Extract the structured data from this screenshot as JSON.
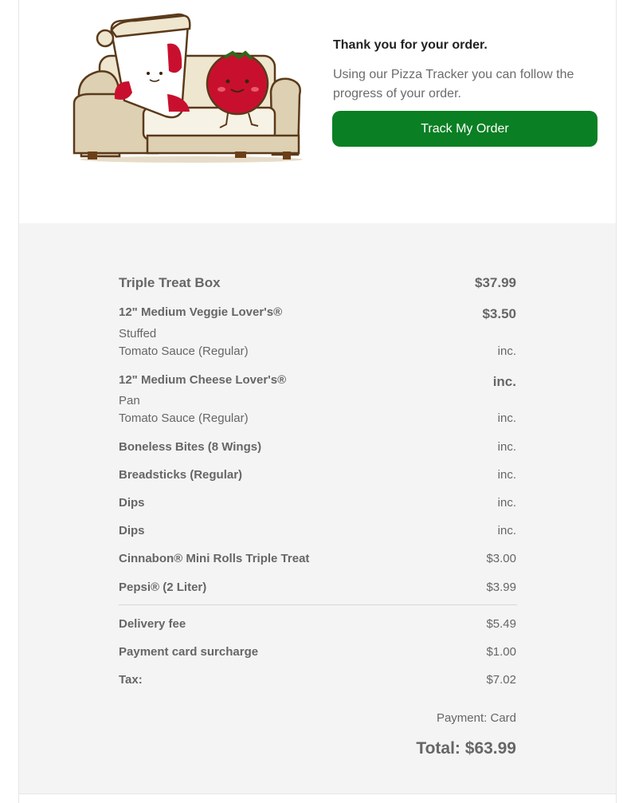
{
  "header": {
    "thanks_title": "Thank you for your order.",
    "thanks_text": "Using our Pizza Tracker you can follow the progress of your order.",
    "track_button": "Track My Order",
    "button_color": "#0a7f23"
  },
  "order": {
    "box_name": "Triple Treat Box",
    "box_price": "$37.99",
    "items": [
      {
        "name": "12\" Medium Veggie Lover's®",
        "price": "$3.50",
        "crust": "Stuffed",
        "sauce": "Tomato Sauce (Regular)",
        "sauce_price": "inc."
      },
      {
        "name": "12\" Medium Cheese Lover's®",
        "price": "inc.",
        "crust": "Pan",
        "sauce": "Tomato Sauce (Regular)",
        "sauce_price": "inc."
      },
      {
        "name": "Boneless Bites (8 Wings)",
        "price": "inc."
      },
      {
        "name": "Breadsticks (Regular)",
        "price": "inc."
      },
      {
        "name": "Dips",
        "price": "inc."
      },
      {
        "name": "Dips",
        "price": "inc."
      },
      {
        "name": "Cinnabon® Mini Rolls Triple Treat",
        "price": "$3.00"
      },
      {
        "name": "Pepsi® (2 Liter)",
        "price": "$3.99"
      }
    ],
    "fees": [
      {
        "name": "Delivery fee",
        "price": "$5.49"
      },
      {
        "name": "Payment card surcharge",
        "price": "$1.00"
      },
      {
        "name": "Tax:",
        "price": "$7.02"
      }
    ],
    "payment": "Payment: Card",
    "total": "Total: $63.99"
  },
  "illustration": {
    "icon": "pizza-and-tomato-on-sofa-icon"
  }
}
